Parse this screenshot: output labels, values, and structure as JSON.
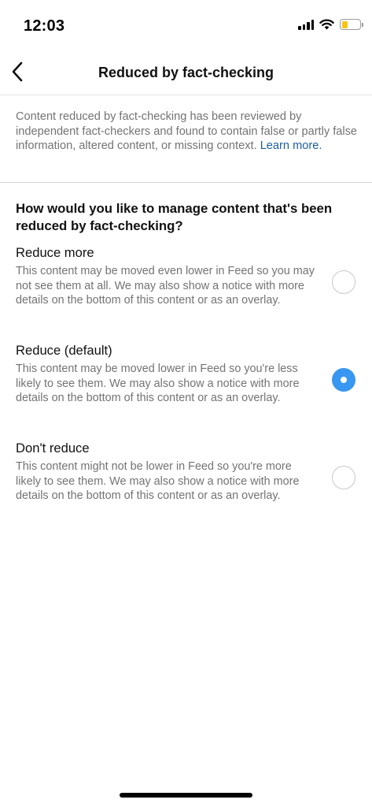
{
  "status_bar": {
    "time": "12:03"
  },
  "header": {
    "title": "Reduced by fact-checking",
    "back_icon": "chevron-left-icon"
  },
  "intro": {
    "text": "Content reduced by fact-checking has been reviewed by independent fact-checkers and found to contain false or partly false information, altered content, or missing context.",
    "link_label": "Learn more."
  },
  "question": "How would you like to manage content that's been reduced by fact-checking?",
  "options": [
    {
      "title": "Reduce more",
      "description": "This content may be moved even lower in Feed so you may not see them at all. We may also show a notice with more details on the bottom of this content or as an overlay.",
      "selected": false
    },
    {
      "title": "Reduce (default)",
      "description": "This content may be moved lower in Feed so you're less likely to see them. We may also show a notice with more details on the bottom of this content or as an overlay.",
      "selected": true
    },
    {
      "title": "Don't reduce",
      "description": "This content might not be lower in Feed so you're more likely to see them. We may also show a notice with more details on the bottom of this content or as an overlay.",
      "selected": false
    }
  ],
  "colors": {
    "accent": "#3897f0",
    "link": "#1b5e9e",
    "secondary_text": "#737373",
    "battery": "#f5c518"
  }
}
